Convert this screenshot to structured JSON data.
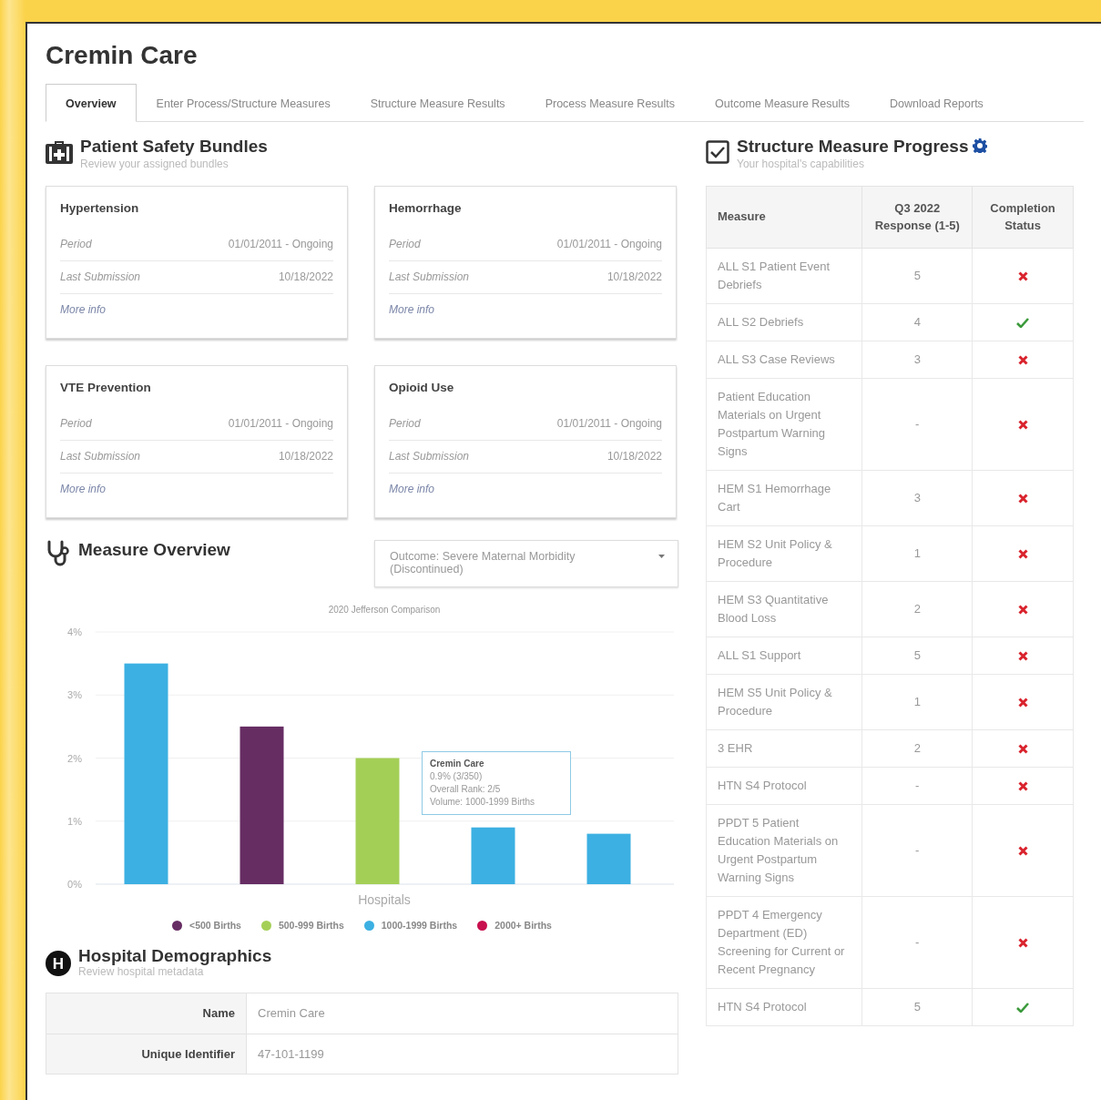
{
  "title": "Cremin Care",
  "tabs": [
    {
      "label": "Overview",
      "selected": true
    },
    {
      "label": "Enter Process/Structure Measures",
      "selected": false
    },
    {
      "label": "Structure Measure Results",
      "selected": false
    },
    {
      "label": "Process Measure Results",
      "selected": false
    },
    {
      "label": "Outcome Measure Results",
      "selected": false
    },
    {
      "label": "Download Reports",
      "selected": false
    }
  ],
  "patient_safety_bundles": {
    "title": "Patient Safety Bundles",
    "subtitle": "Review your assigned bundles",
    "bundles": [
      {
        "name": "Hypertension",
        "rows": [
          {
            "label": "Period",
            "value": "01/01/2011 - Ongoing"
          },
          {
            "label": "Last Submission",
            "value": "10/18/2022"
          }
        ],
        "link": "More info"
      },
      {
        "name": "Hemorrhage",
        "rows": [
          {
            "label": "Period",
            "value": "01/01/2011 - Ongoing"
          },
          {
            "label": "Last Submission",
            "value": "10/18/2022"
          }
        ],
        "link": "More info"
      },
      {
        "name": "VTE Prevention",
        "rows": [
          {
            "label": "Period",
            "value": "01/01/2011 - Ongoing"
          },
          {
            "label": "Last Submission",
            "value": "10/18/2022"
          }
        ],
        "link": "More info"
      },
      {
        "name": "Opioid Use",
        "rows": [
          {
            "label": "Period",
            "value": "01/01/2011 - Ongoing"
          },
          {
            "label": "Last Submission",
            "value": "10/18/2022"
          }
        ],
        "link": "More info"
      }
    ]
  },
  "measure_overview": {
    "title": "Measure Overview",
    "dropdown": {
      "value": "Outcome: Severe Maternal Morbidity (Discontinued)"
    },
    "chart_data": {
      "type": "bar",
      "title": "2020 Jefferson Comparison",
      "xlabel": "Hospitals",
      "ylim": [
        0,
        4
      ],
      "grid": true,
      "yticks": [
        {
          "value": 0,
          "label": "0%"
        },
        {
          "value": 1,
          "label": "1%"
        },
        {
          "value": 2,
          "label": "2%"
        },
        {
          "value": 3,
          "label": "3%"
        },
        {
          "value": 4,
          "label": "4%"
        }
      ],
      "series": [
        {
          "name": "<500 Births",
          "color": "#662d63",
          "values": [
            null,
            2.5,
            null,
            null,
            null
          ]
        },
        {
          "name": "500-999 Births",
          "color": "#a4cf57",
          "values": [
            null,
            null,
            2.0,
            null,
            null
          ]
        },
        {
          "name": "1000-1999 Births",
          "color": "#3cb0e2",
          "values": [
            3.5,
            null,
            null,
            0.9,
            0.8
          ]
        },
        {
          "name": "2000+ Births",
          "color": "#c8104e",
          "values": [
            null,
            null,
            null,
            null,
            null
          ]
        }
      ]
    },
    "tooltip": {
      "lines": [
        "Cremin Care",
        "0.9% (3/350)",
        "Overall Rank: 2/5",
        "Volume: 1000-1999 Births"
      ]
    }
  },
  "hospital_demographics": {
    "icon_text": "H",
    "title": "Hospital Demographics",
    "subtitle": "Review hospital metadata",
    "rows": [
      {
        "label": "Name",
        "value": "Cremin Care"
      },
      {
        "label": "Unique Identifier",
        "value": "47-101-1199"
      }
    ]
  },
  "structure_measure_progress": {
    "title": "Structure Measure Progress",
    "subtitle": "Your hospital's capabilities",
    "columns": [
      "Measure",
      "Q3 2022 Response (1-5)",
      "Completion Status"
    ],
    "rows": [
      {
        "measure": "ALL S1 Patient Event Debriefs",
        "response": "5",
        "complete": false
      },
      {
        "measure": "ALL S2 Debriefs",
        "response": "4",
        "complete": true
      },
      {
        "measure": "ALL S3 Case Reviews",
        "response": "3",
        "complete": false
      },
      {
        "measure": "Patient Education Materials on Urgent Postpartum Warning Signs",
        "response": "-",
        "complete": false
      },
      {
        "measure": "HEM S1 Hemorrhage Cart",
        "response": "3",
        "complete": false
      },
      {
        "measure": "HEM S2 Unit Policy & Procedure",
        "response": "1",
        "complete": false
      },
      {
        "measure": "HEM S3 Quantitative Blood Loss",
        "response": "2",
        "complete": false
      },
      {
        "measure": "ALL S1 Support",
        "response": "5",
        "complete": false
      },
      {
        "measure": "HEM S5 Unit Policy & Procedure",
        "response": "1",
        "complete": false
      },
      {
        "measure": "3 EHR",
        "response": "2",
        "complete": false
      },
      {
        "measure": "HTN S4 Protocol",
        "response": "-",
        "complete": false
      },
      {
        "measure": "PPDT 5 Patient Education Materials on Urgent Postpartum Warning Signs",
        "response": "-",
        "complete": false
      },
      {
        "measure": "PPDT 4 Emergency Department (ED) Screening for Current or Recent Pregnancy",
        "response": "-",
        "complete": false
      },
      {
        "measure": "HTN S4 Protocol",
        "response": "5",
        "complete": true
      }
    ]
  }
}
